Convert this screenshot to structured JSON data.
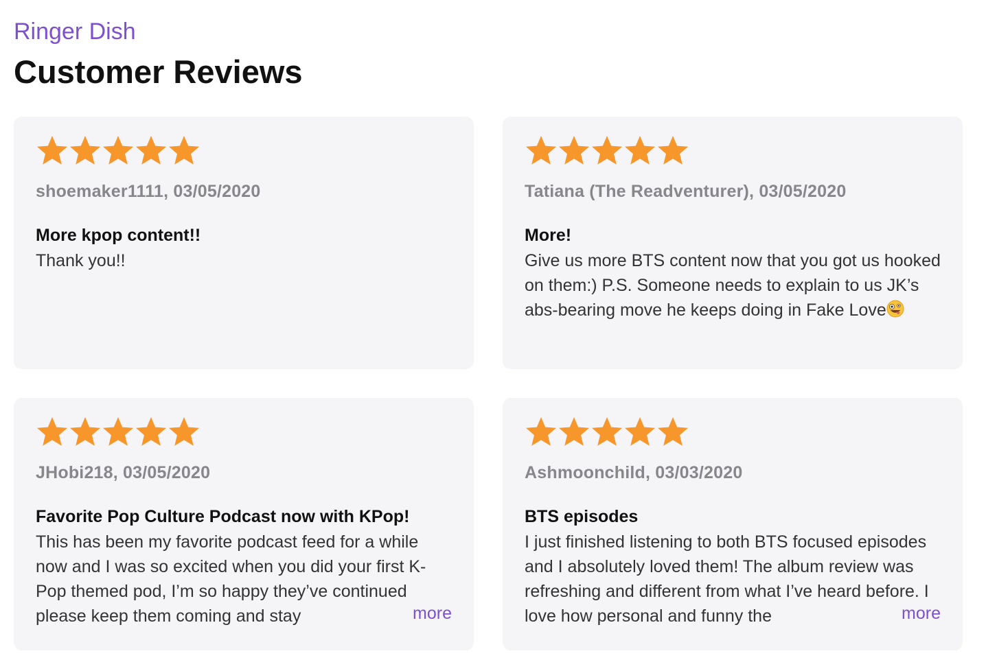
{
  "header": {
    "show_name": "Ringer Dish",
    "title": "Customer Reviews"
  },
  "colors": {
    "accent": "#7d50d0",
    "star": "#f7962b",
    "card_bg": "#f5f5f7",
    "meta_text": "#86868b"
  },
  "reviews": [
    {
      "rating": 5,
      "reviewer": "shoemaker1111, 03/05/2020",
      "title": "More kpop content!!",
      "body": "Thank you!!",
      "truncated": false
    },
    {
      "rating": 5,
      "reviewer": "Tatiana (The Readventurer), 03/05/2020",
      "title": "More!",
      "body": "Give us more BTS content now that you got us hooked on them:) P.S. Someone needs to explain to us JK’s abs-bearing move he keeps doing in Fake Love",
      "emoji": "zany-face-icon",
      "truncated": false
    },
    {
      "rating": 5,
      "reviewer": "JHobi218, 03/05/2020",
      "title": "Favorite Pop Culture Podcast now with KPop!",
      "body": "This has been my favorite podcast feed for a while now and I was so excited when you did your first K-Pop themed pod, I’m so happy they’ve continued please keep them coming and stay",
      "truncated": true,
      "more_label": "more"
    },
    {
      "rating": 5,
      "reviewer": "Ashmoonchild, 03/03/2020",
      "title": "BTS episodes",
      "body": "I just finished listening to both BTS focused episodes and I absolutely loved them! The album review was refreshing and different from what I’ve heard before. I love how personal and funny the",
      "truncated": true,
      "more_label": "more"
    }
  ]
}
